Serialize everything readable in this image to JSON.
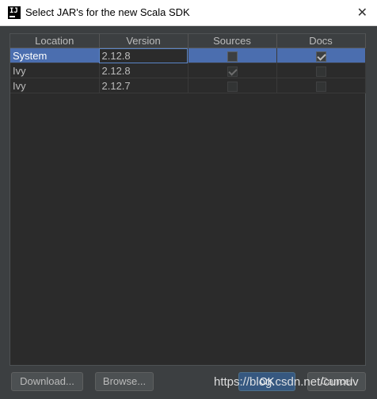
{
  "window": {
    "title": "Select JAR's for the new Scala SDK",
    "app_icon_label": "IJ",
    "close_glyph": "✕"
  },
  "table": {
    "headers": [
      "Location",
      "Version",
      "Sources",
      "Docs"
    ],
    "rows": [
      {
        "location": "System",
        "version": "2.12.8",
        "sources": false,
        "docs": true,
        "selected": true
      },
      {
        "location": "Ivy",
        "version": "2.12.8",
        "sources": true,
        "docs": false,
        "selected": false
      },
      {
        "location": "Ivy",
        "version": "2.12.7",
        "sources": false,
        "docs": false,
        "selected": false
      }
    ]
  },
  "buttons": {
    "download": "Download...",
    "browse": "Browse...",
    "ok": "OK",
    "cancel": "Cancel"
  },
  "watermark": "https://blog.csdn.net/cumuv",
  "colors": {
    "dialog_bg": "#3c3f41",
    "table_bg": "#2b2b2b",
    "selection": "#4b6eaf",
    "primary_button": "#365880"
  }
}
